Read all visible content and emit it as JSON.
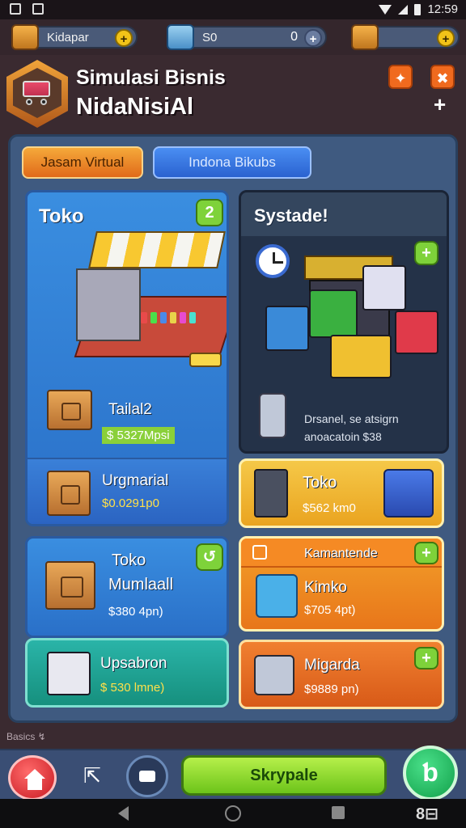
{
  "status_bar": {
    "time": "12:59"
  },
  "resources": [
    {
      "label": "Kidapar",
      "icon": "tape-icon",
      "action": "+"
    },
    {
      "label": "S0",
      "value": "0",
      "icon": "cash-stack-icon",
      "action": "+"
    },
    {
      "label": "",
      "icon": "box-icon",
      "action": "+"
    }
  ],
  "header": {
    "title_line1": "Simulasi Bisnis",
    "title_line2": "NidaNisiAl",
    "btn1": "✦",
    "btn2": "✖",
    "btn3": "+"
  },
  "tabs": [
    {
      "label": "Jasam Virtual"
    },
    {
      "label": "Indona Bikubs"
    }
  ],
  "cards": {
    "toko_shop": {
      "title": "Toko",
      "badge": "2",
      "item_title": "Tailal2",
      "item_price": "$ 5327Mpsi"
    },
    "systade": {
      "title": "Systade!",
      "badge": "+",
      "desc_line1": "Drsanel, se atsigrn",
      "desc_line2": "anoacatoin $38"
    },
    "urgmarial": {
      "title": "Urgmarial",
      "price": "$0.0291p0"
    },
    "toko_gold": {
      "title": "Toko",
      "price": "$562 km0"
    },
    "toko_mumlaall": {
      "title": "Toko",
      "subtitle": "Mumlaall",
      "price": "$380 4pn)",
      "badge": "↺"
    },
    "kamantende": {
      "title": "Kamantende",
      "subtitle": "Kimko",
      "price": "$705 4pt)",
      "badge": "+"
    },
    "upsabron": {
      "title": "Upsabron",
      "price": "$ 530 lmne)"
    },
    "migarda": {
      "title": "Migarda",
      "price": "$9889 pn)",
      "badge": "+"
    }
  },
  "footer_small": {
    "text": "Basics  ↯"
  },
  "bottom_nav": {
    "main_button": "Skrypale",
    "round_button": "ƅ"
  },
  "android_nav": {
    "extra": "8⊟"
  },
  "colors": {
    "background": "#3a2a30",
    "panel": "#3f5a80",
    "card_blue": "#2a70c8",
    "card_gold": "#eaa420",
    "card_orange": "#e8761a",
    "card_teal": "#16907e",
    "accent_green": "#7ed23a"
  }
}
